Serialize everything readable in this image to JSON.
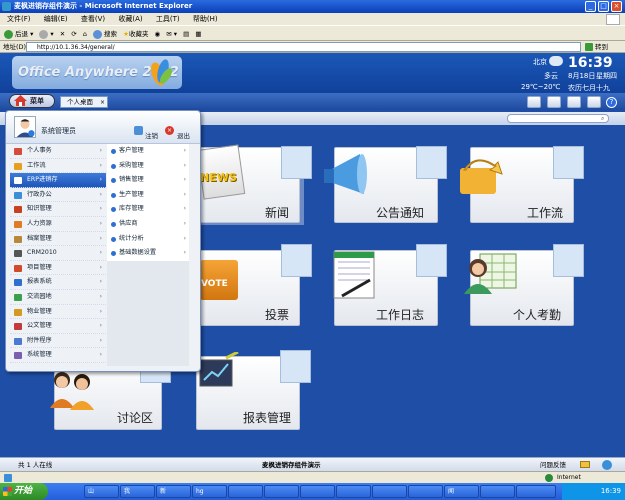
{
  "window": {
    "title": "麦枫进销存组件演示 - Microsoft Internet Explorer"
  },
  "menubar": [
    "文件(F)",
    "编辑(E)",
    "查看(V)",
    "收藏(A)",
    "工具(T)",
    "帮助(H)"
  ],
  "toolbar": {
    "back": "后退",
    "search": "搜索",
    "favorites": "收藏夹"
  },
  "address": {
    "label": "地址(D)",
    "url": "http://10.1.36.34/general/",
    "go": "转到"
  },
  "app": {
    "logo": "Office Anywhere 2012",
    "weather": {
      "city": "北京",
      "condition": "多云",
      "temp": "29℃~20℃"
    },
    "clock": {
      "time": "16:39",
      "date": "8月18日",
      "weekday": "星期四",
      "lunar": "农历七月十九"
    },
    "start_label": "菜单",
    "tab_label": "个人桌面",
    "tab_close": "×"
  },
  "tiles": [
    {
      "label": "新闻"
    },
    {
      "label": "公告通知"
    },
    {
      "label": "工作流"
    },
    {
      "label": "投票"
    },
    {
      "label": "工作日志"
    },
    {
      "label": "个人考勤"
    },
    {
      "label": "讨论区"
    },
    {
      "label": "报表管理"
    }
  ],
  "tile_badges": {
    "news": "NEWS",
    "vote": "VOTE"
  },
  "menu": {
    "user": "系统管理员",
    "logout": "注销",
    "exit": "退出",
    "primary": [
      "个人事务",
      "工作流",
      "ERP进销存",
      "行政办公",
      "知识管理",
      "人力资源",
      "档案管理",
      "CRM2010",
      "项目管理",
      "报表系统",
      "交流园地",
      "物业管理",
      "公文管理",
      "附件程序",
      "系统管理"
    ],
    "selected_index": 2,
    "secondary": [
      "客户管理",
      "采购管理",
      "销售管理",
      "生产管理",
      "库存管理",
      "供应商",
      "统计分析",
      "基础数据设置"
    ]
  },
  "status": {
    "online": "共  1  人在线",
    "center": "麦枫进销存组件演示",
    "feedback": "问题反馈"
  },
  "ie_status": {
    "zone": "Internet"
  },
  "taskbar": {
    "start": "开始",
    "tasks": [
      "山",
      "我",
      "新",
      "hg",
      "",
      "",
      "",
      "",
      "",
      "",
      "闻",
      "",
      ""
    ],
    "clock": "16:39"
  }
}
